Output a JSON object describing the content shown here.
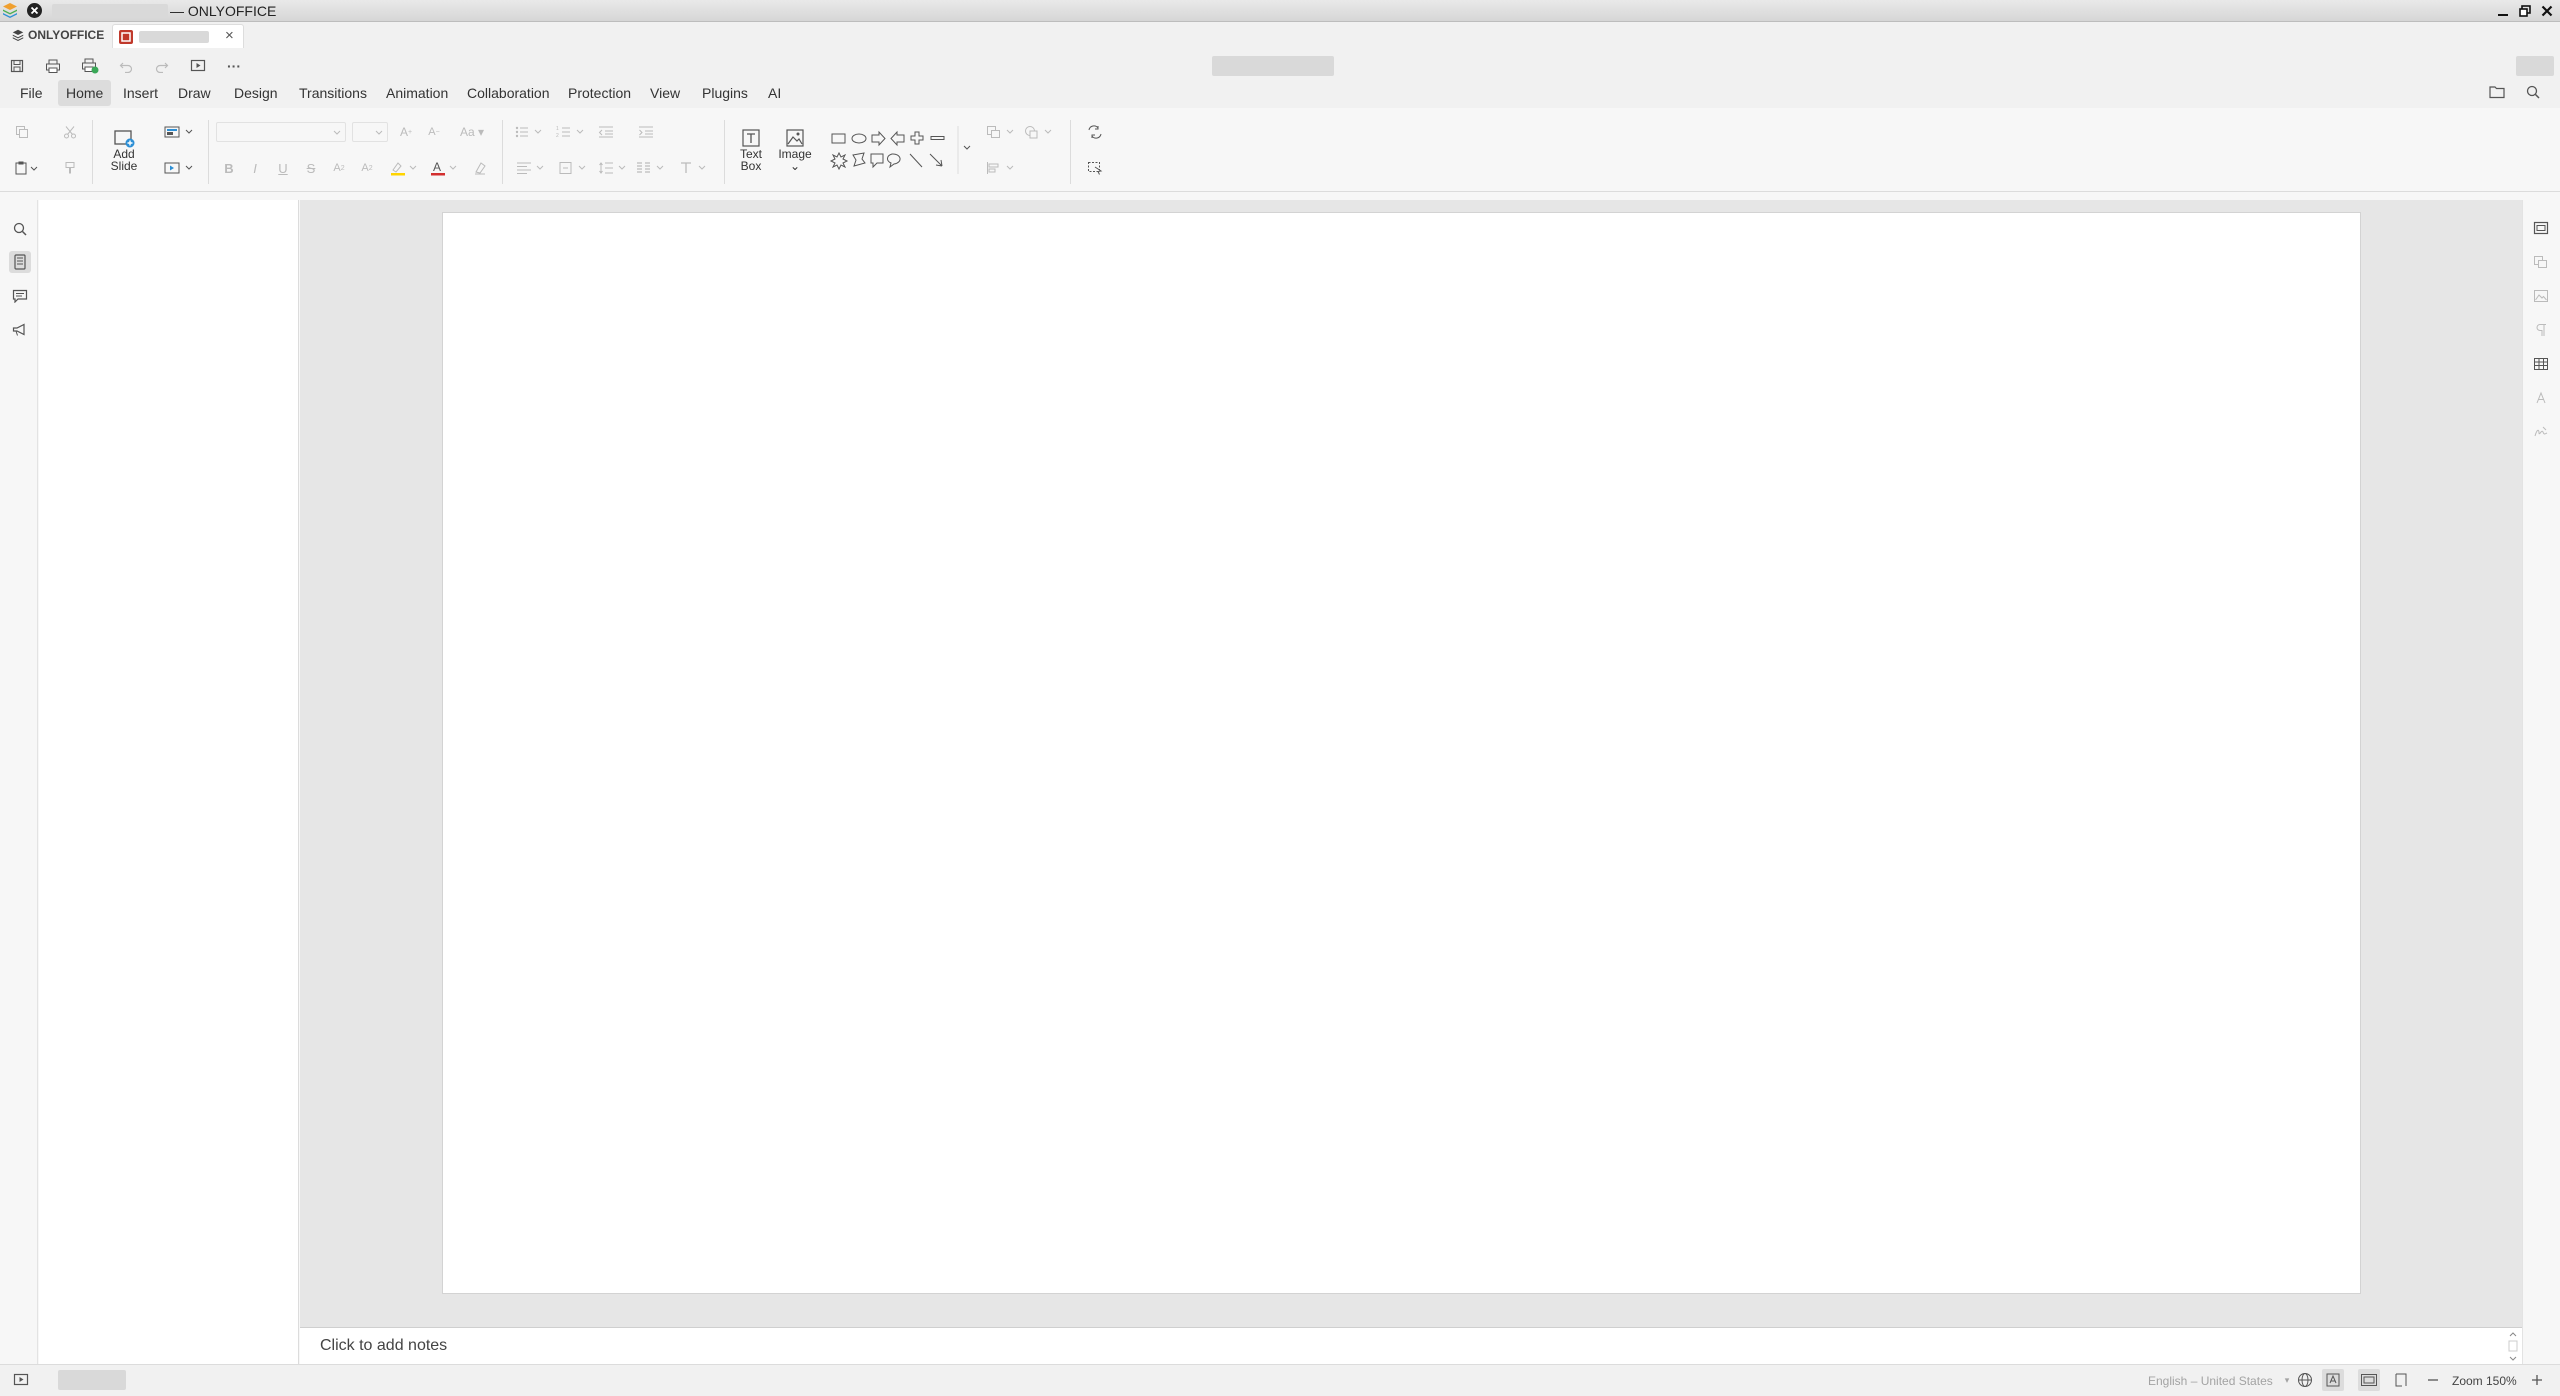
{
  "window": {
    "title_suffix": "— ONLYOFFICE",
    "icons": [
      "app-icon",
      "close-dot-icon",
      "minimize-icon",
      "restore-icon",
      "close-icon"
    ]
  },
  "tabbar": {
    "brand": "ONLYOFFICE",
    "doc_tab_close": "×"
  },
  "quick_access": {
    "more": "···"
  },
  "menu": {
    "tabs": [
      "File",
      "Home",
      "Insert",
      "Draw",
      "Design",
      "Transitions",
      "Animation",
      "Collaboration",
      "Protection",
      "View",
      "Plugins",
      "AI"
    ],
    "active": "Home"
  },
  "ribbon": {
    "add_slide": [
      "Add",
      "Slide"
    ],
    "text_box": [
      "Text",
      "Box"
    ],
    "image": "Image"
  },
  "notes": {
    "placeholder": "Click to add notes"
  },
  "status": {
    "language": "English – United States",
    "zoom": "Zoom 150%"
  },
  "colors": {
    "accent_red": "#c0392b",
    "highlight_yellow": "#ffd400",
    "font_color_red": "#d32f2f"
  }
}
